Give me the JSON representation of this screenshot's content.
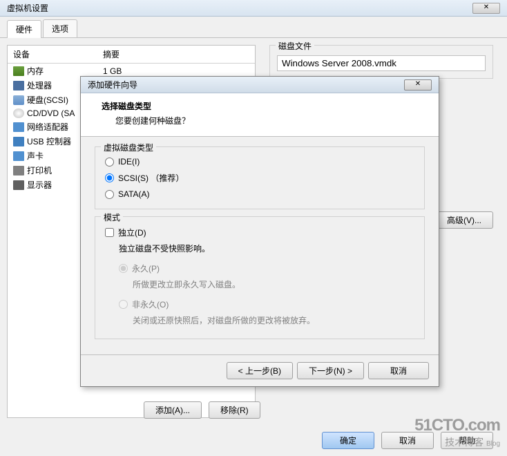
{
  "main": {
    "title": "虚拟机设置",
    "tabs": [
      "硬件",
      "选项"
    ],
    "columns": {
      "device": "设备",
      "summary": "摘要"
    },
    "devices": [
      {
        "icon": "icon-memory",
        "name": "内存",
        "summary": "1 GB"
      },
      {
        "icon": "icon-cpu",
        "name": "处理器",
        "summary": ""
      },
      {
        "icon": "icon-disk",
        "name": "硬盘(SCSI)",
        "summary": ""
      },
      {
        "icon": "icon-cd",
        "name": "CD/DVD (SA",
        "summary": ""
      },
      {
        "icon": "icon-net",
        "name": "网络适配器",
        "summary": ""
      },
      {
        "icon": "icon-usb",
        "name": "USB 控制器",
        "summary": ""
      },
      {
        "icon": "icon-sound",
        "name": "声卡",
        "summary": ""
      },
      {
        "icon": "icon-print",
        "name": "打印机",
        "summary": ""
      },
      {
        "icon": "icon-display",
        "name": "显示器",
        "summary": ""
      }
    ],
    "add_btn": "添加(A)...",
    "remove_btn": "移除(R)",
    "disk_file_label": "磁盘文件",
    "disk_file_value": "Windows Server 2008.vmdk",
    "advanced_btn": "高级(V)...",
    "ok_btn": "确定",
    "cancel_btn": "取消",
    "help_btn": "帮助"
  },
  "wizard": {
    "title": "添加硬件向导",
    "header_title": "选择磁盘类型",
    "header_sub": "您要创建何种磁盘？",
    "disk_type_label": "虚拟磁盘类型",
    "radio_ide": "IDE(I)",
    "radio_scsi": "SCSI(S) （推荐）",
    "radio_sata": "SATA(A)",
    "mode_label": "模式",
    "independent": "独立(D)",
    "independent_desc": "独立磁盘不受快照影响。",
    "persistent": "永久(P)",
    "persistent_desc": "所做更改立即永久写入磁盘。",
    "nonpersistent": "非永久(O)",
    "nonpersistent_desc": "关闭或还原快照后，对磁盘所做的更改将被放弃。",
    "back_btn": "< 上一步(B)",
    "next_btn": "下一步(N) >",
    "cancel_btn": "取消"
  },
  "watermark": {
    "line1": "51CTO.com",
    "line2": "技术博客",
    "line3": "Blog"
  }
}
